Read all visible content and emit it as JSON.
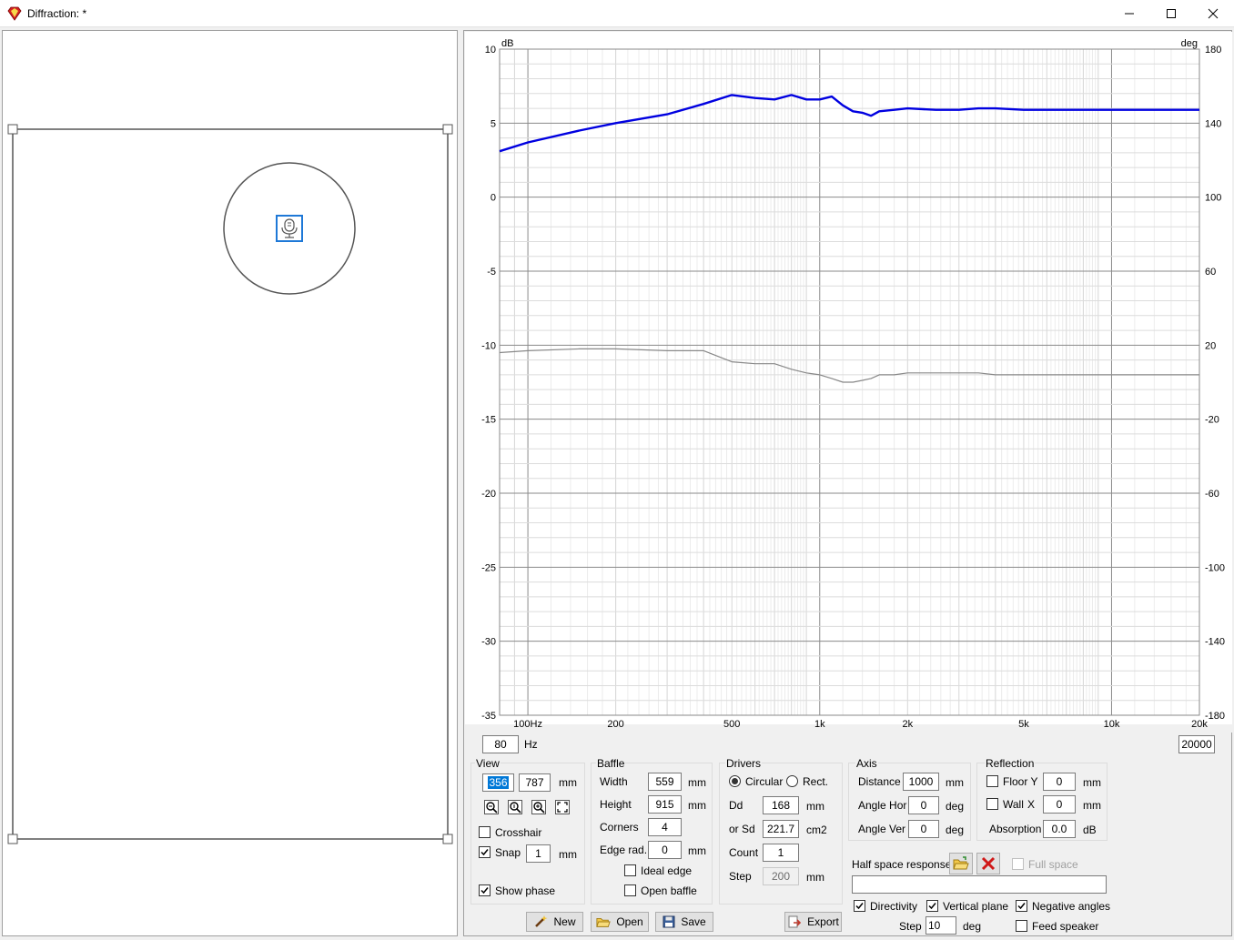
{
  "window": {
    "title": "Diffraction: *"
  },
  "chart_data": {
    "type": "line",
    "x_scale": "log",
    "xlim": [
      80,
      20000
    ],
    "ylim": [
      -35,
      10
    ],
    "y2lim": [
      -180,
      180
    ],
    "ylabel": "dB",
    "y2label": "deg",
    "x_ticks": [
      {
        "v": 100,
        "label": "100Hz"
      },
      {
        "v": 200,
        "label": "200"
      },
      {
        "v": 500,
        "label": "500"
      },
      {
        "v": 1000,
        "label": "1k"
      },
      {
        "v": 2000,
        "label": "2k"
      },
      {
        "v": 5000,
        "label": "5k"
      },
      {
        "v": 10000,
        "label": "10k"
      },
      {
        "v": 20000,
        "label": "20k"
      }
    ],
    "y_ticks": [
      "10",
      "5",
      "0",
      "-5",
      "-10",
      "-15",
      "-20",
      "-25",
      "-30",
      "-35"
    ],
    "y2_ticks": [
      "180",
      "140",
      "100",
      "60",
      "20",
      "-20",
      "-60",
      "-100",
      "-140",
      "-180"
    ],
    "grid": true,
    "series": [
      {
        "color": "#0000e0",
        "axis": "left",
        "x": [
          80,
          100,
          150,
          200,
          300,
          400,
          500,
          600,
          700,
          800,
          900,
          1000,
          1100,
          1200,
          1300,
          1400,
          1500,
          1600,
          1800,
          2000,
          2500,
          3000,
          3500,
          4000,
          5000,
          7000,
          10000,
          15000,
          20000
        ],
        "y": [
          3.1,
          3.7,
          4.5,
          5.0,
          5.6,
          6.3,
          6.9,
          6.7,
          6.6,
          6.9,
          6.6,
          6.6,
          6.8,
          6.2,
          5.8,
          5.7,
          5.5,
          5.8,
          5.9,
          6.0,
          5.9,
          5.9,
          6.0,
          6.0,
          5.9,
          5.9,
          5.9,
          5.9,
          5.9
        ]
      },
      {
        "color": "#888888",
        "axis": "right",
        "x": [
          80,
          100,
          150,
          200,
          300,
          400,
          500,
          600,
          700,
          800,
          900,
          1000,
          1100,
          1200,
          1300,
          1400,
          1500,
          1600,
          1800,
          2000,
          2500,
          3000,
          3500,
          4000,
          5000,
          7000,
          10000,
          15000,
          20000
        ],
        "y": [
          16,
          17,
          18,
          18,
          17,
          17,
          11,
          10,
          10,
          7,
          5,
          4,
          2,
          0,
          0,
          1,
          2,
          4,
          4,
          5,
          5,
          5,
          5,
          4,
          4,
          4,
          4,
          4,
          4
        ]
      }
    ]
  },
  "range": {
    "min": "80",
    "hz": "Hz",
    "max": "20000"
  },
  "view": {
    "title": "View",
    "w": "356",
    "h": "787",
    "unit": "mm",
    "crosshair": "Crosshair",
    "snap": "Snap",
    "snap_value": "1",
    "snap_unit": "mm",
    "show_phase": "Show phase"
  },
  "baffle": {
    "title": "Baffle",
    "width_label": "Width",
    "width": "559",
    "height_label": "Height",
    "height": "915",
    "corners_label": "Corners",
    "corners": "4",
    "edge_label": "Edge rad.",
    "edge": "0",
    "unit": "mm",
    "ideal_edge": "Ideal edge",
    "open_baffle": "Open baffle"
  },
  "drivers": {
    "title": "Drivers",
    "circular": "Circular",
    "rect": "Rect.",
    "dd_label": "Dd",
    "dd": "168",
    "dd_unit": "mm",
    "sd_label": "or Sd",
    "sd": "221.7",
    "sd_unit": "cm2",
    "count_label": "Count",
    "count": "1",
    "step_label": "Step",
    "step": "200",
    "step_unit": "mm"
  },
  "axis": {
    "title": "Axis",
    "distance_label": "Distance",
    "distance": "1000",
    "distance_unit": "mm",
    "hor_label": "Angle Hor",
    "hor": "0",
    "ver_label": "Angle Ver",
    "ver": "0",
    "unit": "deg"
  },
  "reflection": {
    "title": "Reflection",
    "floor_label": "Floor Y",
    "floor": "0",
    "wall_label": "Wall",
    "wall_x": "X",
    "wall": "0",
    "unit": "mm",
    "absorption_label": "Absorption",
    "absorption": "0.0",
    "absorption_unit": "dB"
  },
  "half_space": {
    "label": "Half space response",
    "full_space": "Full space",
    "file": ""
  },
  "directivity": {
    "label": "Directivity",
    "vertical": "Vertical plane",
    "negative": "Negative angles",
    "step_label": "Step",
    "step": "10",
    "step_unit": "deg",
    "feed": "Feed speaker"
  },
  "buttons": {
    "new": "New",
    "open": "Open",
    "save": "Save",
    "export": "Export"
  }
}
